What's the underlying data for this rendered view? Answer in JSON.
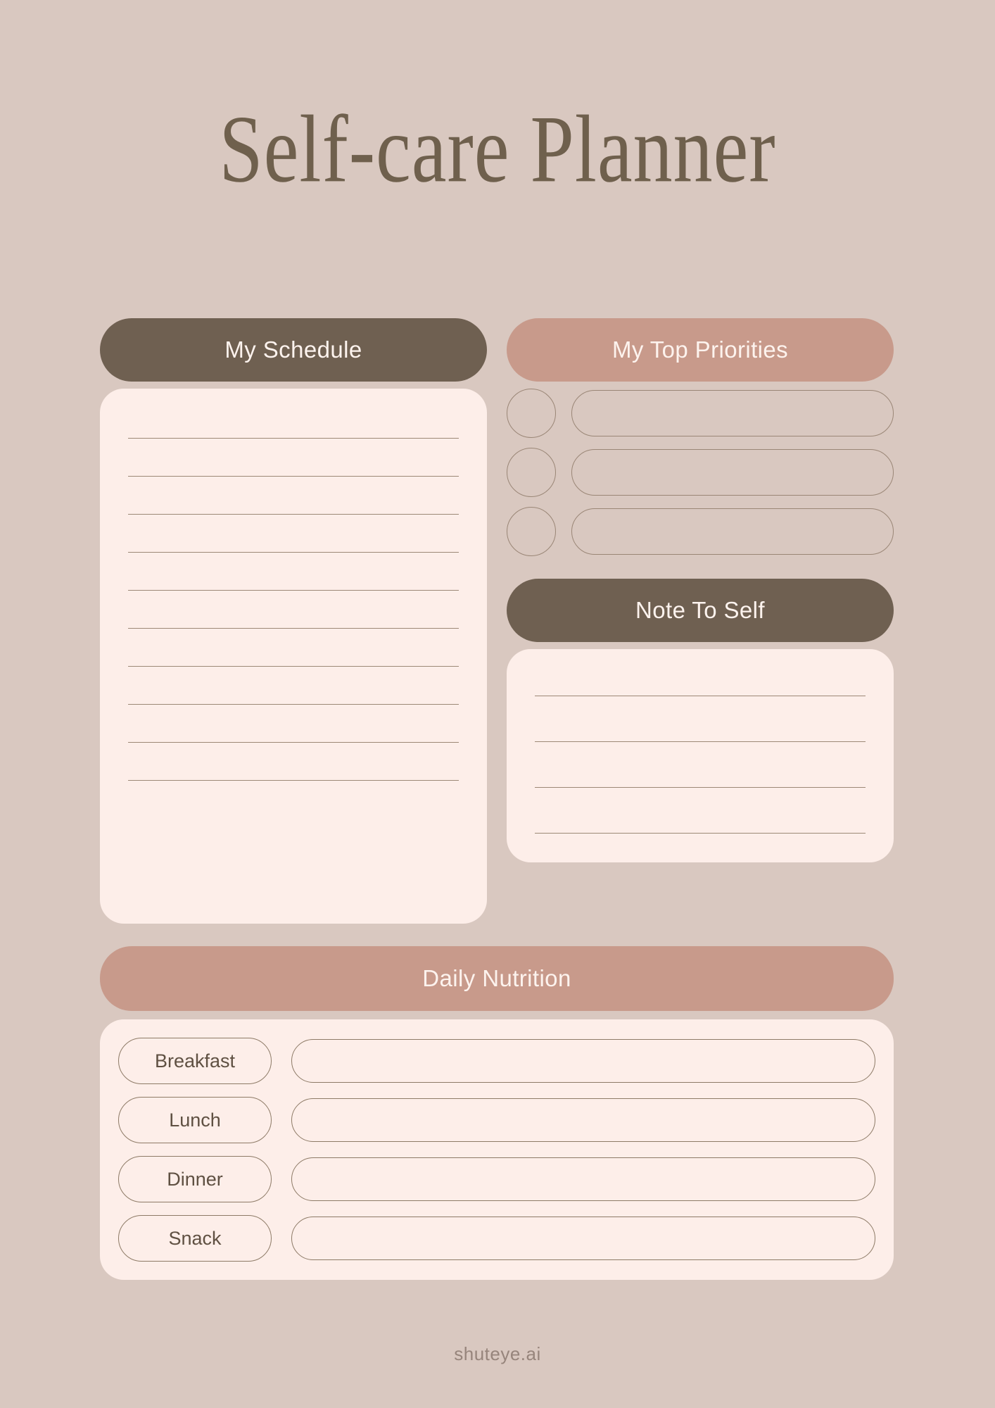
{
  "page": {
    "title": "Self-care Planner",
    "background_color": "#d9c8c0",
    "footer_watermark": "shuteye.ai"
  },
  "colors": {
    "background": "#d9c8c0",
    "dark_brown": "#6f6051",
    "rose": "#c89a8b",
    "cream_card": "#fdeee9",
    "rule_line": "#9c8876",
    "outline": "#8d7a66",
    "title_text": "#6f604d",
    "header_text": "#fdf3ee",
    "label_text": "#5f5042",
    "footer_text": "#97857c"
  },
  "schedule": {
    "header": "My Schedule",
    "header_style": "dark",
    "line_count": 10
  },
  "priorities": {
    "header": "My Top Priorities",
    "header_style": "rose",
    "rows": [
      {
        "checkbox": "",
        "value": ""
      },
      {
        "checkbox": "",
        "value": ""
      },
      {
        "checkbox": "",
        "value": ""
      }
    ]
  },
  "note_to_self": {
    "header": "Note To Self",
    "header_style": "dark",
    "line_count": 4
  },
  "daily_nutrition": {
    "header": "Daily Nutrition",
    "header_style": "rose",
    "meals": [
      {
        "label": "Breakfast",
        "value": ""
      },
      {
        "label": "Lunch",
        "value": ""
      },
      {
        "label": "Dinner",
        "value": ""
      },
      {
        "label": "Snack",
        "value": ""
      }
    ]
  }
}
